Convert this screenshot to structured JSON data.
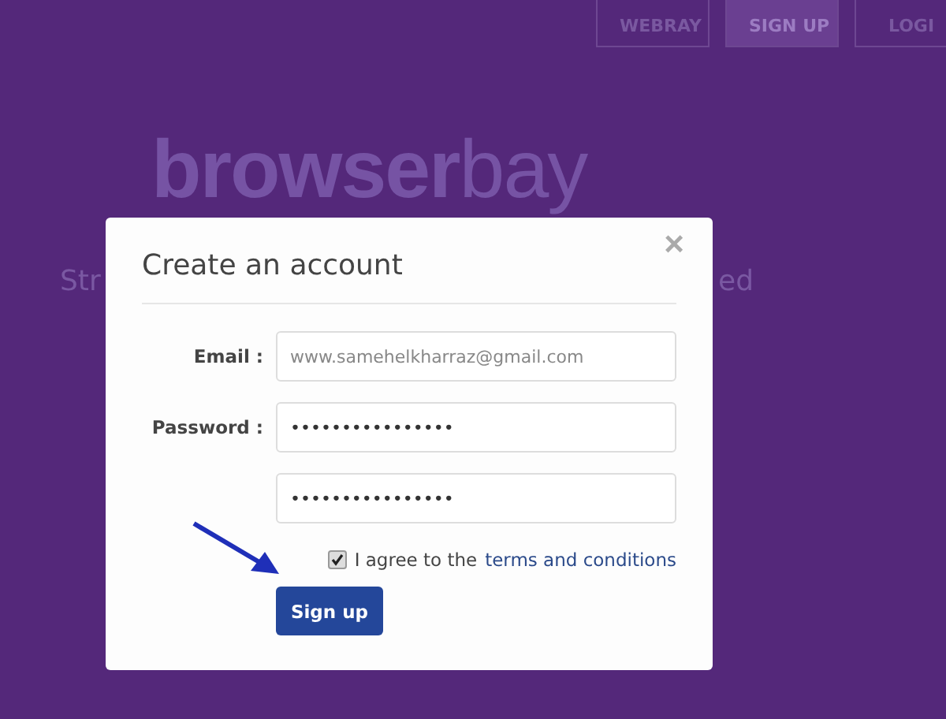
{
  "nav": [
    {
      "label": "WEBRAY",
      "selected": false
    },
    {
      "label": "SIGN UP",
      "selected": true
    },
    {
      "label": "LOGI",
      "selected": false
    }
  ],
  "hero": {
    "logo_bold": "browser",
    "logo_light": "bay",
    "tagline_start": "Str",
    "tagline_end": "ed"
  },
  "dialog": {
    "title": "Create an account",
    "close": "×",
    "fields": [
      {
        "label": "Email :",
        "placeholder": "www.samehelkharraz@gmail.com"
      },
      {
        "label": "Password :",
        "value": "••••••••••••••••"
      },
      {
        "value": "••••••••••••••••"
      }
    ],
    "agree": {
      "checked": true,
      "text": "I agree to the",
      "link": "terms and conditions"
    },
    "submit": "Sign up"
  }
}
